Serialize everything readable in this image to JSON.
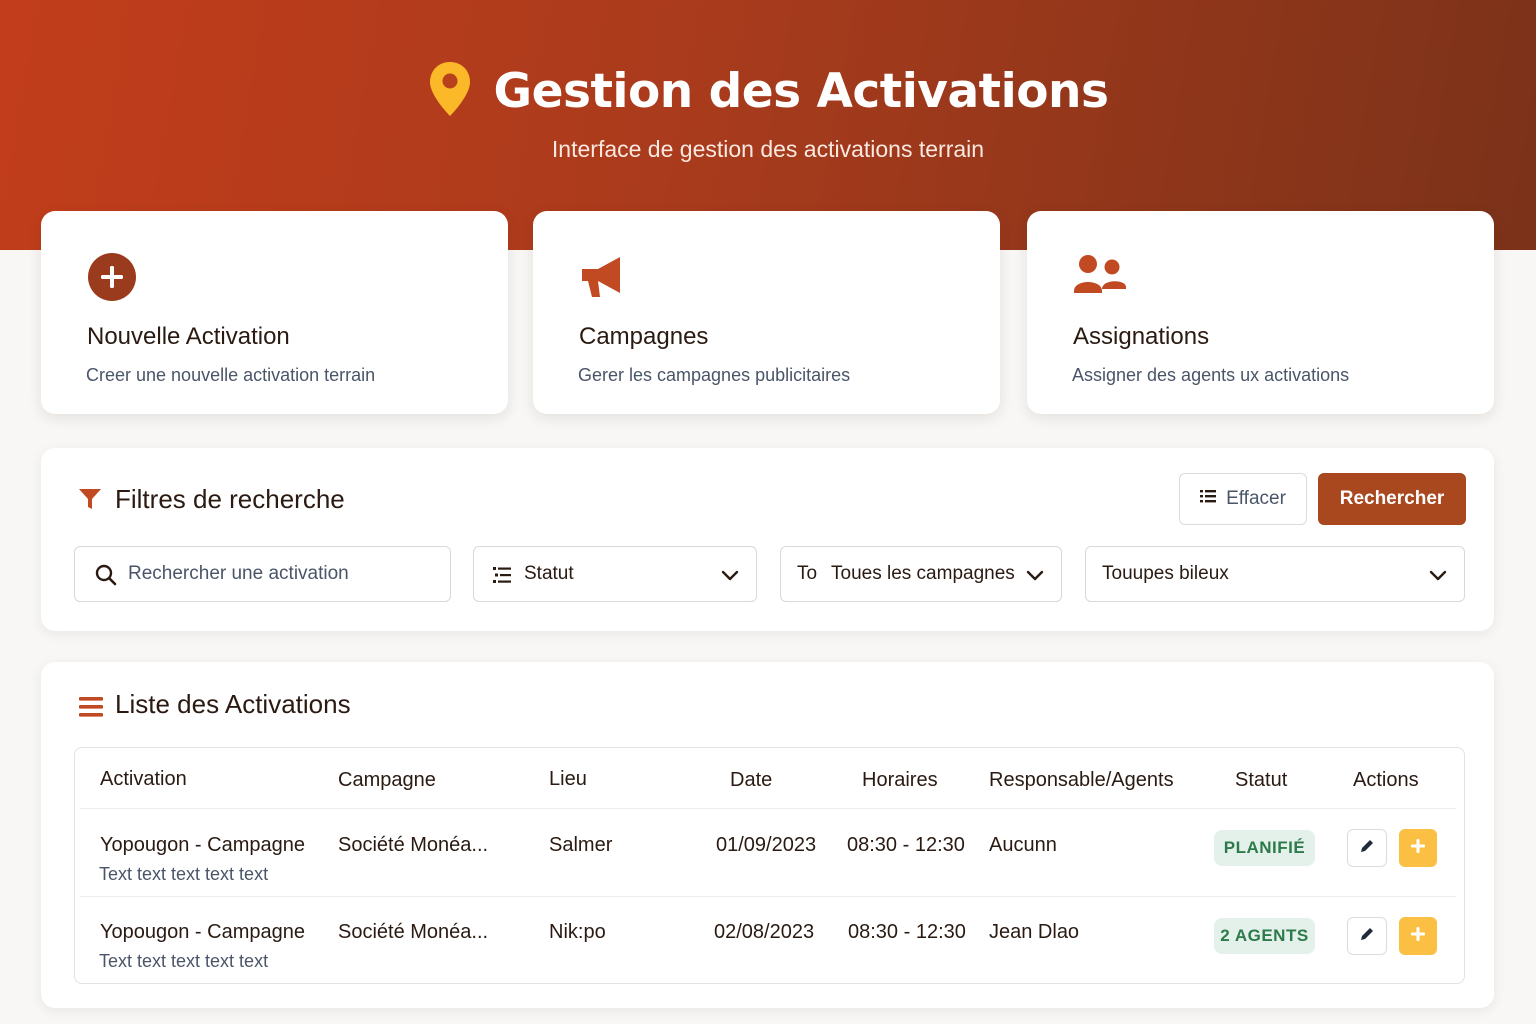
{
  "header": {
    "title": "Gestion des Activations",
    "subtitle": "Interface de gestion des activations terrain",
    "icon": "map-pin-icon"
  },
  "cards": [
    {
      "icon": "plus-circle-icon",
      "title": "Nouvelle Activation",
      "description": "Creer une nouvelle activation terrain"
    },
    {
      "icon": "megaphone-icon",
      "title": "Campagnes",
      "description": "Gerer les campagnes publicitaires"
    },
    {
      "icon": "users-icon",
      "title": "Assignations",
      "description": "Assigner des agents ux activations"
    }
  ],
  "filters": {
    "title": "Filtres de recherche",
    "clear_label": "Effacer",
    "search_label": "Rechercher",
    "search_placeholder": "Rechercher une activation",
    "status_label": "Statut",
    "campaign_prefix": "To",
    "campaign_label": "Toues les campagnes",
    "groups_label": "Touupes bileux"
  },
  "list": {
    "title": "Liste des Activations",
    "columns": [
      "Activation",
      "Campagne",
      "Lieu",
      "Date",
      "Horaires",
      "Responsable/Agents",
      "Statut",
      "Actions"
    ],
    "rows": [
      {
        "activation": "Yopougon - Campagne",
        "activation_sub": "Text text text text text",
        "campaign": "Société Monéa...",
        "place": "Salmer",
        "date": "01/09/2023",
        "hours": "08:30 - 12:30",
        "responsible": "Aucunn",
        "status": "PLANIFIÉ"
      },
      {
        "activation": "Yopougon - Campagne",
        "activation_sub": "Text text text text text",
        "campaign": "Société Monéa...",
        "place": "Nik:po",
        "date": "02/08/2023",
        "hours": "08:30 - 12:30",
        "responsible": "Jean Dlao",
        "status": "2 AGENTS"
      }
    ]
  },
  "colors": {
    "brand": "#a9471f",
    "header_start": "#c23d1b",
    "header_end": "#7b3219",
    "pin": "#fbb829",
    "badge_bg": "#e3f1ea",
    "badge_text": "#2d7a4b",
    "add_button": "#fbc043"
  }
}
